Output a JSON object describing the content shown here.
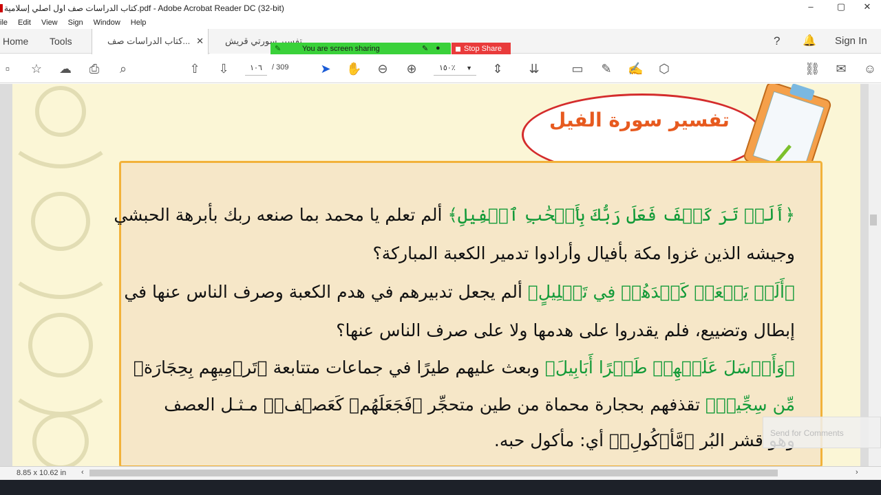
{
  "window": {
    "title": "كتاب الدراسات صف اول اصلي إسلامية.pdf - Adobe Acrobat Reader DC (32-bit)"
  },
  "menu": [
    "ile",
    "Edit",
    "View",
    "Sign",
    "Window",
    "Help"
  ],
  "tabs": {
    "home": "Home",
    "tools": "Tools",
    "doc1": "كتاب الدراسات صف...",
    "doc2": "تفسير سورتي قريش...",
    "signin": "Sign In"
  },
  "screen_share": {
    "message": "You are screen sharing",
    "stop": "Stop Share"
  },
  "toolbar": {
    "page_current": "١٠٦",
    "page_total": "/ 309",
    "zoom": "١٥٠٪"
  },
  "page": {
    "title": "تفسير سورة الفيل",
    "lines": [
      {
        "quran": "﴿أَلَمۡ تَرَ كَيۡفَ فَعَلَ رَبُّكَ بِأَصۡحَٰبِ ٱلۡفِيلِ﴾",
        "text": " ألم تعلم يا محمد بما صنعه ربك بأبرهة الحبشي"
      },
      {
        "quran": "",
        "text": "وجيشه الذين غزوا مكة بأفيال وأرادوا تدمير الكعبة المباركة؟"
      },
      {
        "quran": "﴿أَلَمۡ يَجۡعَلۡ كَيۡدَهُمۡ فِي تَضۡلِيلٍ﴾",
        "text": " ألم يجعل تدبيرهم في هدم الكعبة وصرف الناس عنها في"
      },
      {
        "quran": "",
        "text": "إبطال وتضييع، فلم يقدروا على هدمها ولا على صرف الناس عنها؟"
      },
      {
        "quran": "﴿وَأَرۡسَلَ عَلَيۡهِمۡ طَيۡرًا أَبَابِيلَ﴾",
        "text": " وبعث عليهم طيرًا في جماعات متتابعة ﴿تَرۡمِيهِم بِحِجَارَةٖ"
      },
      {
        "quran": "مِّن سِجِّيلٖ﴾",
        "text": " تقذفهم بحجارة محماة من طين متحجِّر ﴿فَجَعَلَهُمۡ كَعَصۡفٖ﴾ مـثـل العصف"
      },
      {
        "quran": "",
        "text": "وهو قشر البُر ﴿مَّأۡكُولِۭ﴾ أي: مأكول حبه."
      }
    ]
  },
  "status": {
    "size": "8.85 x 10.62 in",
    "comment_hint": "Send for Comments"
  }
}
